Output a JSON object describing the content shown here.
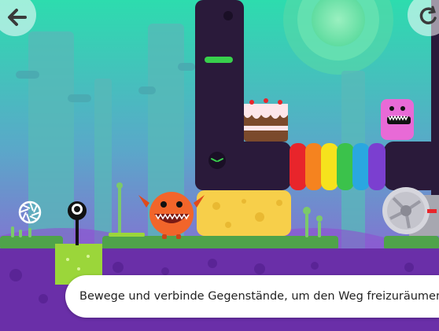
{
  "hud": {
    "back_icon": "arrow-left-icon",
    "restart_icon": "restart-icon",
    "camera_icon": "camera-shutter-icon",
    "gear_icon": "gear-icon"
  },
  "caption": {
    "text": "Bewege und verbinde Gegenstände, um den Weg freizuräumen"
  },
  "colors": {
    "sky_top": "#2fd6a8",
    "sky_bottom": "#9b4fd8",
    "pillar": "#2a1a3a",
    "ground": "#4fa34a",
    "ground_dirt": "#6a2fa8",
    "cheese": "#f7cf4a",
    "rainbow": [
      "#e8252b",
      "#f5831f",
      "#f6e21d",
      "#3bc24b",
      "#2aa7e0",
      "#7b3fd0"
    ],
    "orange_monster": "#f2652a",
    "pink_monster": "#e86ad6",
    "green_block": "#9bd63a"
  }
}
